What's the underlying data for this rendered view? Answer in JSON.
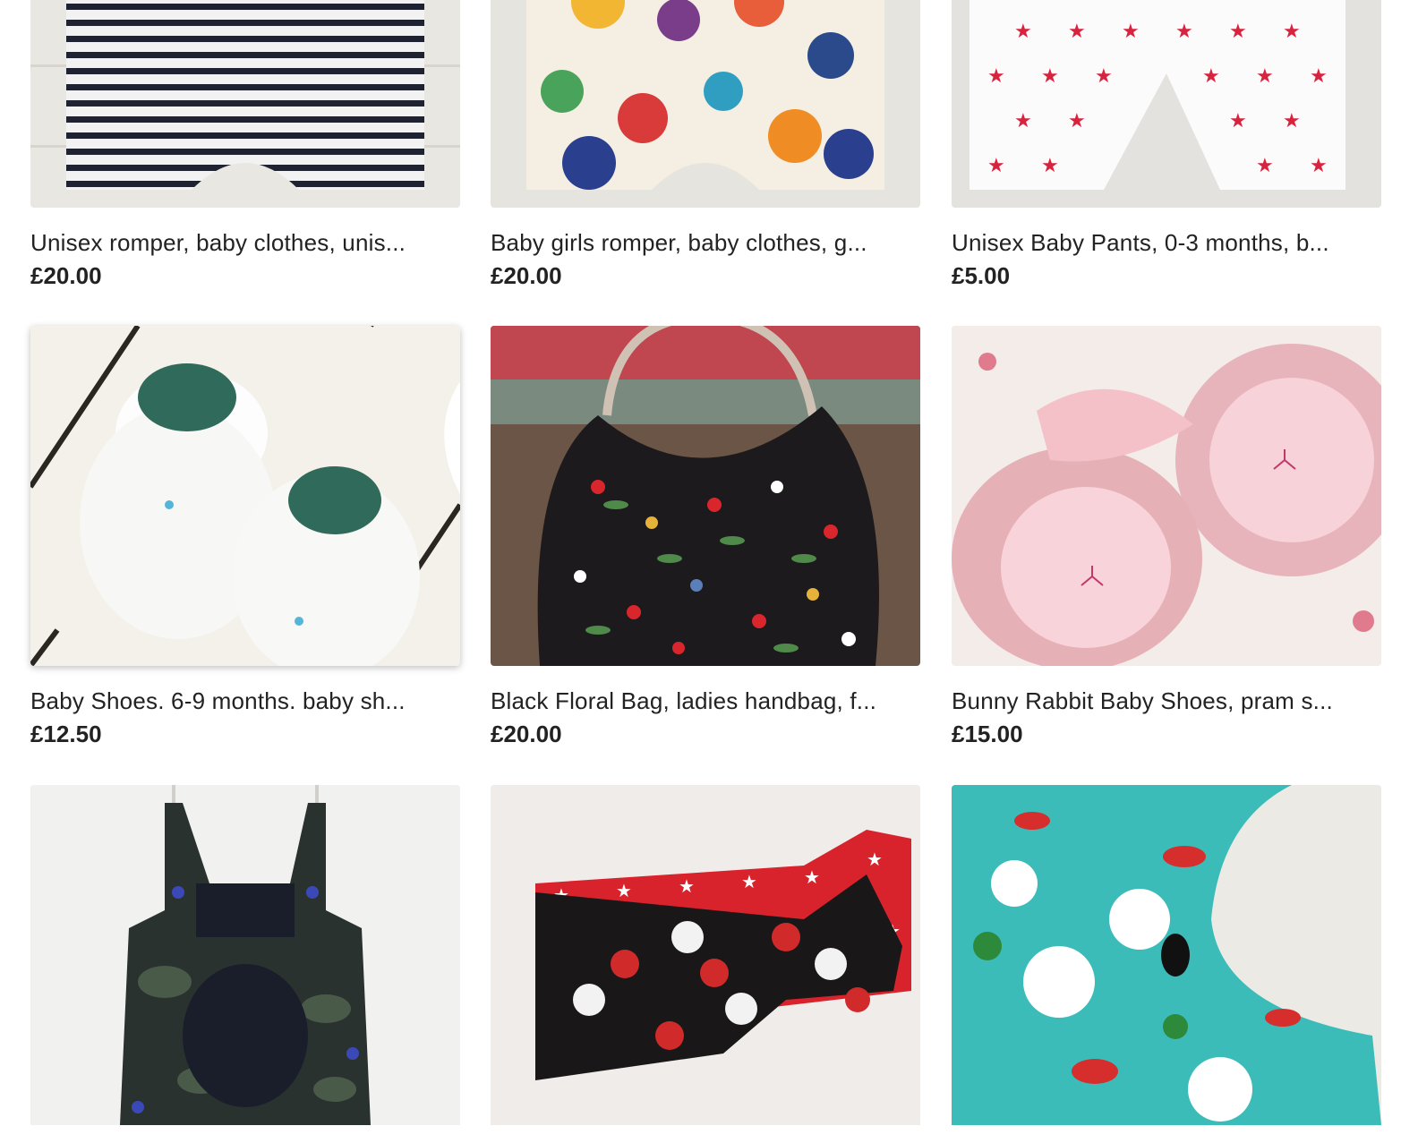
{
  "listings": [
    {
      "title": "Unisex romper, baby clothes, unis...",
      "price": "£20.00"
    },
    {
      "title": "Baby girls romper, baby clothes, g...",
      "price": "£20.00"
    },
    {
      "title": "Unisex Baby Pants, 0-3 months, b...",
      "price": "£5.00"
    },
    {
      "title": "Baby Shoes. 6-9 months. baby sh...",
      "price": "£12.50"
    },
    {
      "title": "Black Floral Bag, ladies handbag, f...",
      "price": "£20.00"
    },
    {
      "title": "Bunny Rabbit Baby Shoes, pram s...",
      "price": "£15.00"
    },
    {
      "title": "",
      "price": ""
    },
    {
      "title": "",
      "price": ""
    },
    {
      "title": "",
      "price": ""
    }
  ],
  "icons": {
    "favorite": "heart-outline-icon"
  },
  "colors": {
    "text": "#222222",
    "background": "#ffffff"
  }
}
